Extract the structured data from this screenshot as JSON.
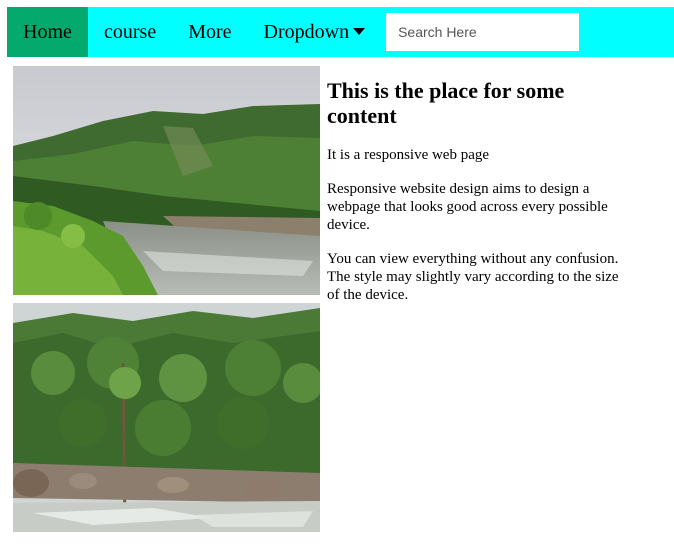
{
  "nav": {
    "items": [
      {
        "label": "Home",
        "active": true
      },
      {
        "label": "course",
        "active": false
      },
      {
        "label": "More",
        "active": false
      },
      {
        "label": "Dropdown",
        "active": false
      }
    ],
    "search_placeholder": "Search Here",
    "search_value": ""
  },
  "colors": {
    "navbar_bg": "#00ffff",
    "active_item_bg": "#04aa6d"
  },
  "images": [
    {
      "icon": "river-landscape-photo"
    },
    {
      "icon": "forest-river-photo"
    }
  ],
  "content": {
    "heading": "This is the place for some content",
    "paragraphs": [
      "It is a responsive web page",
      "Responsive website design aims to design a webpage that looks good across every possible device.",
      "You can view everything without any confusion. The style may slightly vary according to the size of the device."
    ]
  }
}
